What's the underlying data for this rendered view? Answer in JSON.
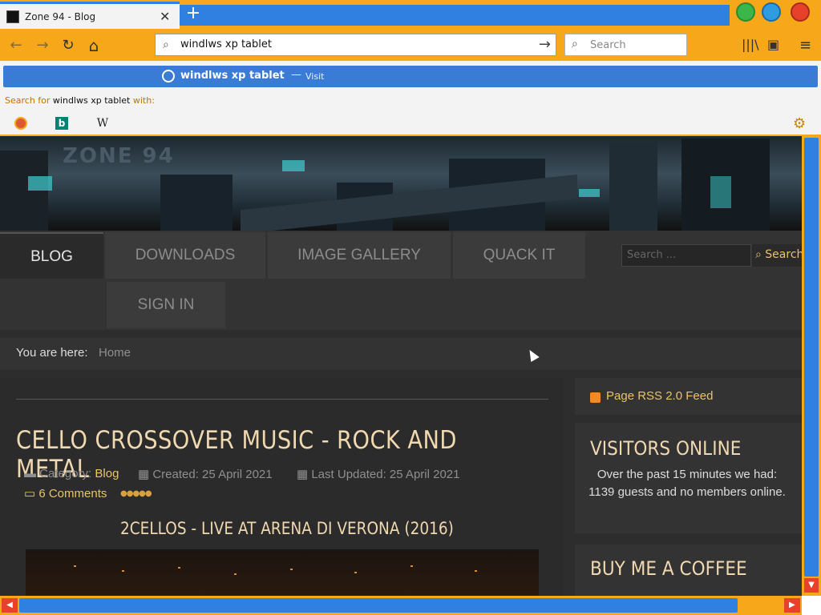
{
  "browser": {
    "tab_title": "Zone 94 - Blog",
    "close_glyph": "✕",
    "new_tab_glyph": "+",
    "url_text": "windlws xp tablet",
    "search_placeholder": "Search",
    "back_glyph": "←",
    "forward_glyph": "→",
    "reload_glyph": "↻",
    "home_glyph": "⌂",
    "go_glyph": "→",
    "library_glyph": "|||\\",
    "sidebar_glyph": "▣",
    "menu_glyph": "≡"
  },
  "dropdown": {
    "suggestion_text": "windlws xp tablet",
    "suggestion_dash": "—",
    "suggestion_visit": "Visit",
    "search_for_prefix": "Search for ",
    "search_for_query": "windlws xp tablet",
    "search_for_suffix": " with:",
    "engines": [
      "duckduckgo-icon",
      "bing-icon",
      "wikipedia-icon"
    ],
    "wiki_glyph": "W",
    "bing_glyph": "b",
    "gear_glyph": "⚙"
  },
  "site": {
    "menu": [
      "BLOG",
      "DOWNLOADS",
      "IMAGE GALLERY",
      "QUACK IT",
      "SIGN IN"
    ],
    "search_placeholder": "Search ...",
    "search_button": "Search",
    "breadcrumb_label": "You are here:",
    "breadcrumb_home": "Home"
  },
  "article": {
    "title": "CELLO CROSSOVER MUSIC - ROCK AND METAL",
    "category_label": "Category:",
    "category_value": "Blog",
    "created": "Created: 25 April 2021",
    "updated": "Last Updated: 25 April 2021",
    "comments": "6 Comments",
    "stars": "●●●●●",
    "subtitle": "2CELLOS - LIVE AT ARENA DI VERONA (2016)"
  },
  "sidebar": {
    "rss": "Page RSS 2.0 Feed",
    "visitors_title": "VISITORS ONLINE",
    "visitors_text": "Over the past 15 minutes we had: 1139 guests and no members online.",
    "coffee_title": "BUY ME A COFFEE"
  },
  "colors": {
    "chrome_orange": "#f6a71a",
    "chrome_blue": "#2f80e0",
    "accent_gold": "#e8c46a"
  }
}
